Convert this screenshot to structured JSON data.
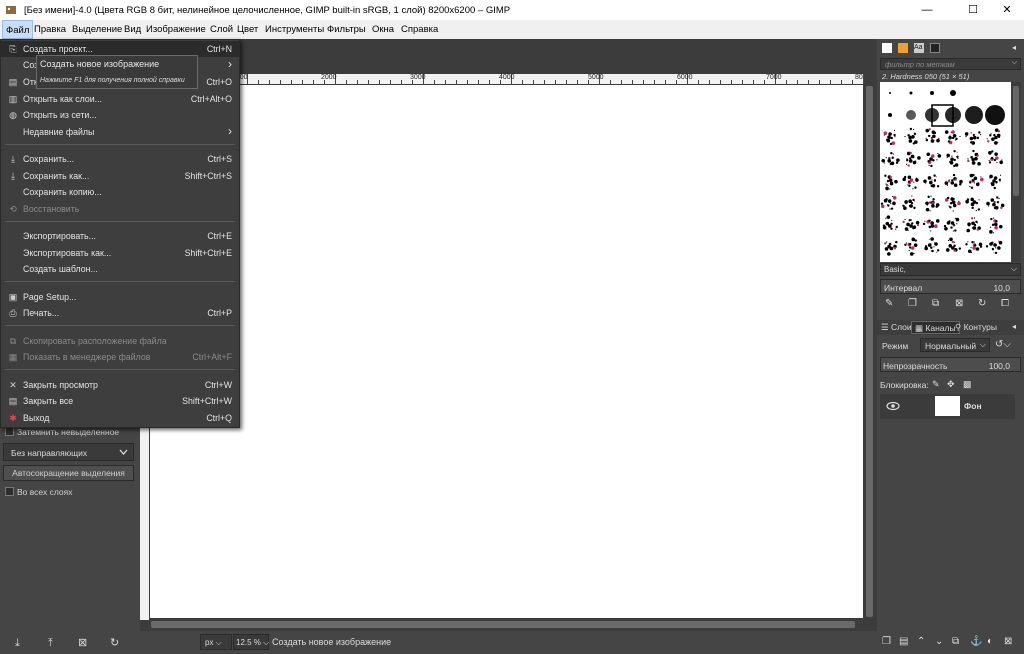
{
  "window": {
    "title": "[Без имени]-4.0 (Цвета RGB 8 бит, нелинейное целочисленное, GIMP built-in sRGB, 1 слой) 8200x6200 – GIMP",
    "minimize": "—",
    "maximize": "☐",
    "close": "✕"
  },
  "menubar": [
    "Файл",
    "Правка",
    "Выделение",
    "Вид",
    "Изображение",
    "Слой",
    "Цвет",
    "Инструменты",
    "Фильтры",
    "Окна",
    "Справка"
  ],
  "file_menu": {
    "items": [
      {
        "label": "Создать проект...",
        "shortcut": "Ctrl+N",
        "icon": "new-icon"
      },
      {
        "label": "Созд",
        "shortcut": "",
        "icon": "",
        "submenu": "›"
      },
      {
        "label": "Отк",
        "shortcut": "Ctrl+O",
        "icon": "open-icon"
      },
      {
        "label": "Открыть как слои...",
        "shortcut": "Ctrl+Alt+O",
        "icon": "open-layers-icon"
      },
      {
        "label": "Открыть из сети...",
        "shortcut": "",
        "icon": "globe-icon"
      },
      {
        "label": "Недавние файлы",
        "shortcut": "",
        "submenu": "›"
      },
      {
        "label": "Сохранить...",
        "shortcut": "Ctrl+S",
        "icon": "save-icon"
      },
      {
        "label": "Сохранить как...",
        "shortcut": "Shift+Ctrl+S",
        "icon": "save-as-icon"
      },
      {
        "label": "Сохранить копию...",
        "shortcut": ""
      },
      {
        "label": "Восстановить",
        "shortcut": "",
        "icon": "revert-icon",
        "disabled": true
      },
      {
        "label": "Экспортировать...",
        "shortcut": "Ctrl+E"
      },
      {
        "label": "Экспортировать как...",
        "shortcut": "Shift+Ctrl+E"
      },
      {
        "label": "Создать шаблон...",
        "shortcut": ""
      },
      {
        "label": "Page Setup...",
        "shortcut": "",
        "icon": "page-setup-icon"
      },
      {
        "label": "Печать...",
        "shortcut": "Ctrl+P",
        "icon": "print-icon"
      },
      {
        "label": "Скопировать расположение файла",
        "shortcut": "",
        "icon": "copy-location-icon",
        "disabled": true
      },
      {
        "label": "Показать в менеджере файлов",
        "shortcut": "Ctrl+Alt+F",
        "icon": "file-manager-icon",
        "disabled": true
      },
      {
        "label": "Закрыть просмотр",
        "shortcut": "Ctrl+W",
        "icon": "close-view-icon"
      },
      {
        "label": "Закрыть все",
        "shortcut": "Shift+Ctrl+W",
        "icon": "close-all-icon"
      },
      {
        "label": "Выход",
        "shortcut": "Ctrl+Q",
        "icon": "quit-icon"
      }
    ]
  },
  "tooltip": {
    "title": "Создать новое изображение",
    "hint": "Нажмите F1 для получения полной справки"
  },
  "toolbox": {
    "dim_unselected": "Затемнить невыделенное",
    "guides": "Без направляющих",
    "autoshrink": "Автосокращение выделения",
    "all_layers": "Во всех слоях"
  },
  "rulers": {
    "h_labels": [
      "1000",
      "2000",
      "3000",
      "4000",
      "5000",
      "6000",
      "7000",
      "80"
    ],
    "v_labels": [
      "1",
      "0",
      "0",
      "0",
      "2",
      "0",
      "0",
      "0",
      "3",
      "0",
      "0",
      "0",
      "4",
      "0",
      "0",
      "0",
      "5",
      "0",
      "0",
      "0",
      "6"
    ]
  },
  "statusbar": {
    "unit": "px",
    "zoom": "12.5 %",
    "message": "Создать новое изображение"
  },
  "dock": {
    "filter_placeholder": "фильтр по меткам",
    "brush_name": "2. Hardness 050 (51 × 51)",
    "brush_preset": "Basic,",
    "spacing_label": "Интервал",
    "spacing_value": "10,0",
    "tabs": [
      "Слои",
      "Каналы",
      "Контуры"
    ],
    "mode_label": "Режим",
    "mode_value": "Нормальный",
    "opacity_label": "Непрозрачность",
    "opacity_value": "100,0",
    "lock_label": "Блокировка:",
    "layer_name": "Фон"
  }
}
